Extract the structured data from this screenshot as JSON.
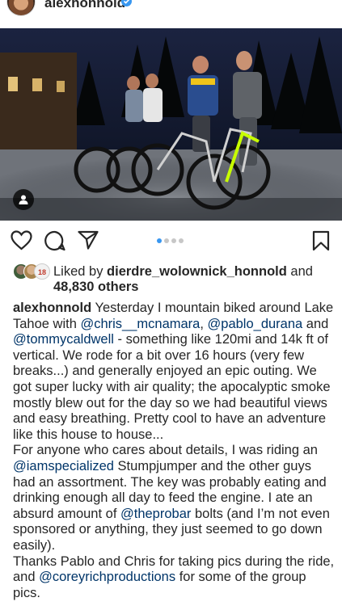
{
  "header": {
    "username": "alexhonnold",
    "verified_icon": "verified-badge-icon",
    "more_icon": "more-dots-icon"
  },
  "photo": {
    "alt_icon": "bike-group-photo",
    "tag_icon": "person-tag-icon"
  },
  "actions": {
    "icons": [
      "heart-icon",
      "comment-icon",
      "share-icon",
      "bookmark-icon"
    ],
    "carousel": {
      "count": 4,
      "active": 0
    }
  },
  "likes": {
    "prefix": "Liked by ",
    "user": "dierdre_wolownick_honnold",
    "and": " and",
    "count": "48,830 others"
  },
  "caption": {
    "author": "alexhonnold",
    "p1_t1": " Yesterday I mountain biked around Lake Tahoe with ",
    "m1": "@chris__mcnamara",
    "p1_t2": ", ",
    "m2": "@pablo_durana",
    "p1_t3": " and ",
    "m3": "@tommycaldwell",
    "p1_t4": " - something like 120mi and 14k ft of vertical. We rode for a bit over 16 hours (very few breaks...) and generally enjoyed an epic outing. We got super lucky with air quality; the apocalyptic smoke mostly blew out for the day so we had beautiful views and easy breathing. Pretty cool to have an adventure like this house to house...",
    "p2_t1": "For anyone who cares about details, I was riding an ",
    "m4": "@iamspecialized",
    "p2_t2": " Stumpjumper and the other guys had an assortment. The key was probably eating and drinking enough all day to feed the engine. I ate an absurd amount of ",
    "m5": "@theprobar",
    "p2_t3": " bolts (and I’m not even sponsored or anything, they just seemed to go down easily).",
    "p3_t1": "Thanks Pablo and Chris for taking pics during the ride, and ",
    "m6": "@coreyrichproductions",
    "p3_t2": " for some of the group pics."
  },
  "colors": {
    "accent": "#3897f0",
    "mention": "#003569",
    "text": "#262626"
  }
}
